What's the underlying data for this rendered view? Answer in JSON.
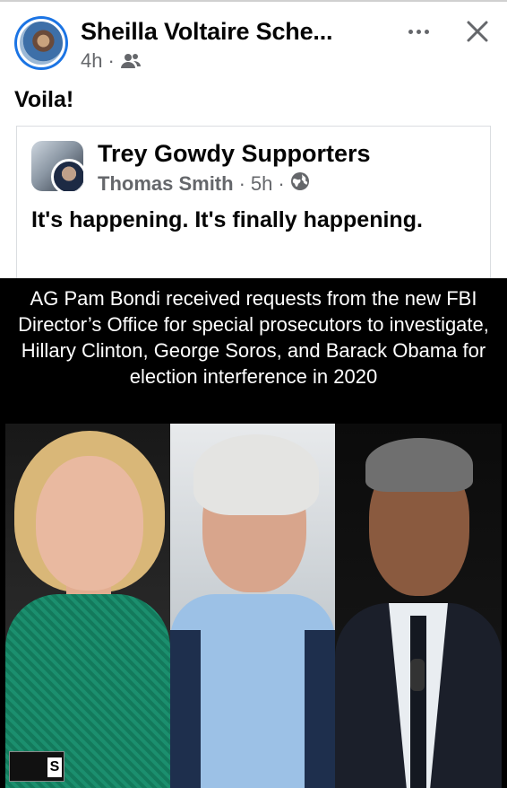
{
  "post": {
    "author": "Sheilla Voltaire Sche...",
    "time": "4h",
    "separator": "·",
    "audience_icon": "friends-icon",
    "text": "Voila!",
    "more_icon": "more-options-icon",
    "close_icon": "close-icon"
  },
  "shared_post": {
    "group_name": "Trey Gowdy Supporters",
    "author": "Thomas Smith",
    "time": "5h",
    "separator": "·",
    "privacy_icon": "globe-icon",
    "text": "It's happening. It's finally happening."
  },
  "image": {
    "headline": "AG Pam Bondi received requests from the new FBI Director’s Office for special prosecutors to investigate, Hillary Clinton, George Soros, and Barack Obama for election interference in 2020"
  },
  "colors": {
    "meta_gray": "#65676b",
    "text": "#050505",
    "border": "#dadde1",
    "avatar_ring": "#1b74e4"
  }
}
